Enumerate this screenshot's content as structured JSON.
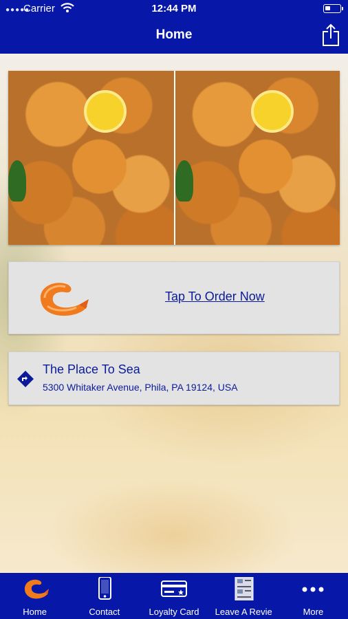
{
  "status_bar": {
    "carrier": "Carrier",
    "time": "12:44 PM"
  },
  "nav": {
    "title": "Home",
    "share_icon": "share-icon"
  },
  "colors": {
    "brand_blue": "#0718a8",
    "link_blue": "#0a1a99",
    "card_bg": "#e3e3e3"
  },
  "order": {
    "label": "Tap To Order Now",
    "icon": "shrimp-icon"
  },
  "location": {
    "name": "The Place To Sea",
    "address": "5300 Whitaker Avenue, Phila, PA 19124, USA",
    "icon": "directions-icon"
  },
  "tabs": [
    {
      "label": "Home",
      "icon": "shrimp-icon"
    },
    {
      "label": "Contact",
      "icon": "phone-icon"
    },
    {
      "label": "Loyalty Card",
      "icon": "loyalty-card-icon"
    },
    {
      "label": "Leave A Revie",
      "icon": "review-icon"
    },
    {
      "label": "More",
      "icon": "more-icon"
    }
  ]
}
